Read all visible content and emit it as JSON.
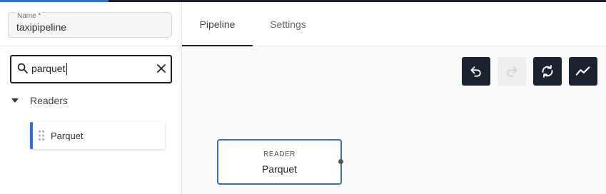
{
  "pipeline_name": {
    "label": "Name *",
    "value": "taxipipeline"
  },
  "search": {
    "value": "parquet",
    "icon": "search-icon",
    "clear_icon": "close-icon"
  },
  "component_tree": {
    "group_label": "Readers",
    "items": [
      {
        "label": "Parquet"
      }
    ]
  },
  "tabs": [
    {
      "label": "Pipeline",
      "active": true
    },
    {
      "label": "Settings",
      "active": false
    }
  ],
  "toolbar": {
    "buttons": [
      {
        "icon": "undo-icon",
        "enabled": true
      },
      {
        "icon": "redo-icon",
        "enabled": false
      },
      {
        "icon": "refresh-icon",
        "enabled": true
      },
      {
        "icon": "chart-icon",
        "enabled": true
      }
    ]
  },
  "canvas": {
    "nodes": [
      {
        "type": "READER",
        "name": "Parquet"
      }
    ]
  },
  "colors": {
    "accent": "#2f6fde",
    "toolbar_button": "#1c2330",
    "top_bar": "#1c1c28"
  }
}
